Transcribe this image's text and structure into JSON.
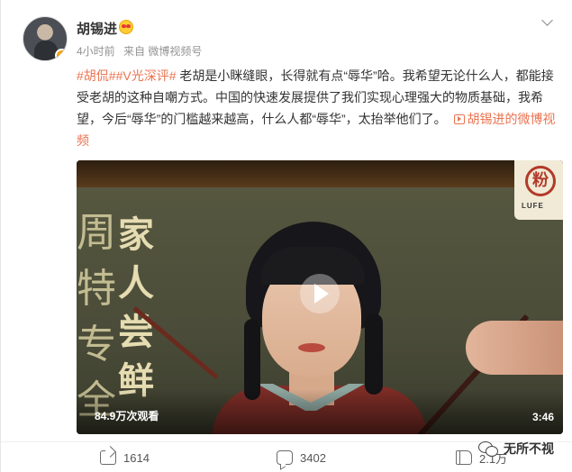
{
  "user": {
    "name": "胡锡进",
    "badge_letter": "v"
  },
  "meta": {
    "time": "4小时前",
    "source": "来自 微博视频号"
  },
  "post": {
    "tag1": "#胡侃#",
    "tag2": "#V光深评#",
    "text": " 老胡是小眯缝眼，长得就有点“辱华”哈。我希望无论什么人，都能接受老胡的这种自嘲方式。中国的快速发展提供了我们实现心理强大的物质基础，我希望，今后“辱华”的门槛越来越高，什么人都“辱华”，太抬举他们了。",
    "video_link": "胡锡进的微博视频"
  },
  "video": {
    "views": "84.9万次观看",
    "duration": "3:46",
    "left_chars": "家人尝鲜",
    "left_edge_chars": "周特专全",
    "logo_text": "LUFE",
    "logo_char": "粉"
  },
  "actions": {
    "share": "1614",
    "comment": "3402",
    "like": "2.1万"
  },
  "watermark": "无所不视"
}
